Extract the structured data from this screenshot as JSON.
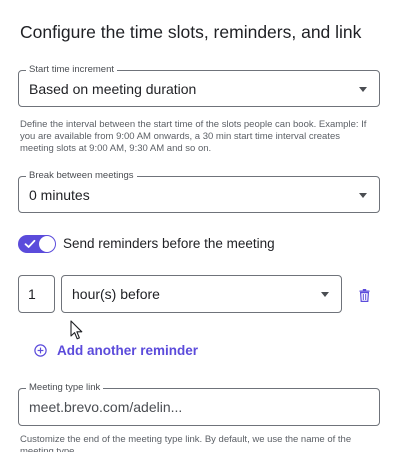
{
  "title": "Configure the time slots, reminders, and link",
  "start_time_increment": {
    "label": "Start time increment",
    "value": "Based on meeting duration",
    "helper": "Define the interval between the start time of the slots people can book. Example: If you are available from 9:00 AM onwards, a 30 min start time interval creates meeting slots at 9:00 AM, 9:30 AM and so on."
  },
  "break_between_meetings": {
    "label": "Break between meetings",
    "value": "0 minutes"
  },
  "reminders": {
    "toggle_on": true,
    "toggle_label": "Send reminders before the meeting",
    "amount": "1",
    "unit": "hour(s) before",
    "add_label": "Add another reminder"
  },
  "meeting_link": {
    "label": "Meeting type link",
    "value": "meet.brevo.com/adelin...",
    "helper": "Customize the end of the meeting type link. By default, we use the name of the meeting type."
  },
  "colors": {
    "accent": "#5b4bdb",
    "border": "#6f737a",
    "text": "#1f2024"
  },
  "icons": [
    "check-icon",
    "chevron-down-icon",
    "trash-icon",
    "plus-circle-icon",
    "mouse-cursor-icon"
  ]
}
